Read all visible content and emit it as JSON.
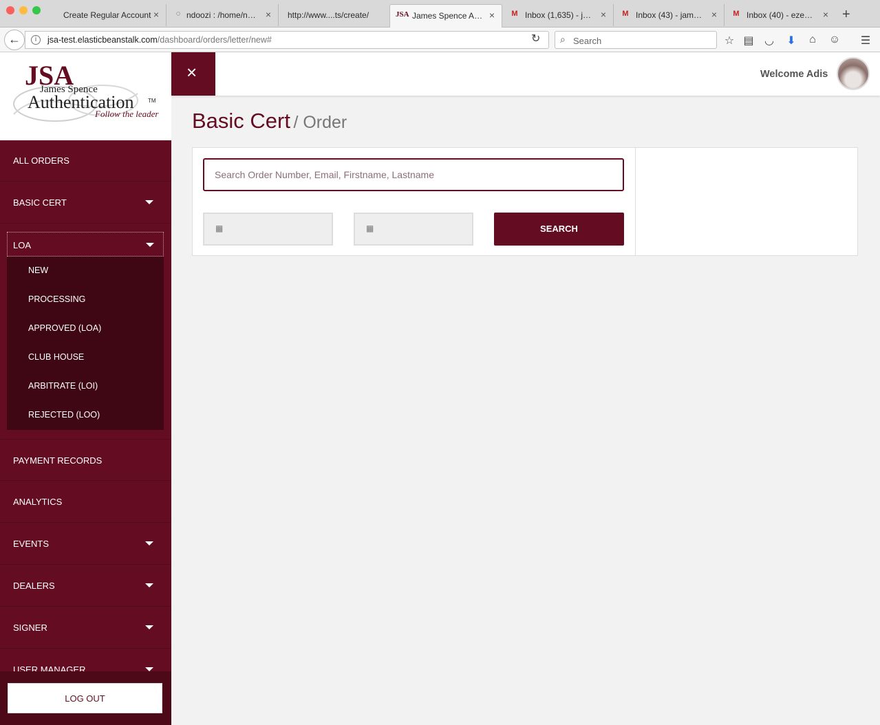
{
  "browser": {
    "tabs": [
      {
        "label": "Create Regular Account",
        "icon": "none"
      },
      {
        "label": "ndoozi : /home/nd...",
        "icon": "spinner-icon"
      },
      {
        "label": "http://www....ts/create/",
        "icon": "none"
      },
      {
        "label": "James Spence Au...",
        "icon": "jsa-favicon"
      },
      {
        "label": "Inbox (1,635) - ja...",
        "icon": "gmail-icon"
      },
      {
        "label": "Inbox (43) - jame...",
        "icon": "gmail-icon"
      },
      {
        "label": "Inbox (40) - ezec...",
        "icon": "gmail-icon"
      }
    ],
    "url_host": "jsa-test.elasticbeanstalk.com",
    "url_path": "/dashboard/orders/letter/new#",
    "search_placeholder": "Search"
  },
  "logo": {
    "jsa": "JSA",
    "name": "James Spence",
    "auth": "Authentication",
    "tm": "TM",
    "tagline": "Follow the leader"
  },
  "sidebar": {
    "items": [
      {
        "label": "ALL ORDERS",
        "caret": false
      },
      {
        "label": "BASIC CERT",
        "caret": true
      },
      {
        "label": "LOA",
        "caret": true
      },
      {
        "label": "PAYMENT RECORDS",
        "caret": false
      },
      {
        "label": "ANALYTICS",
        "caret": false
      },
      {
        "label": "EVENTS",
        "caret": true
      },
      {
        "label": "DEALERS",
        "caret": true
      },
      {
        "label": "SIGNER",
        "caret": true
      },
      {
        "label": "USER MANAGER",
        "caret": true
      }
    ],
    "loa_sub": [
      "NEW",
      "PROCESSING",
      "APPROVED (LOA)",
      "CLUB HOUSE",
      "ARBITRATE (LOI)",
      "REJECTED (LOO)"
    ],
    "logout": "LOG OUT"
  },
  "topbar": {
    "close_glyph": "×",
    "welcome": "Welcome Adis"
  },
  "page": {
    "title": "Basic Cert",
    "crumb": "/ Order",
    "search_placeholder": "Search Order Number, Email, Firstname, Lastname",
    "search_button": "SEARCH"
  },
  "colors": {
    "brand": "#640c21",
    "brand_dark": "#3e0713"
  }
}
